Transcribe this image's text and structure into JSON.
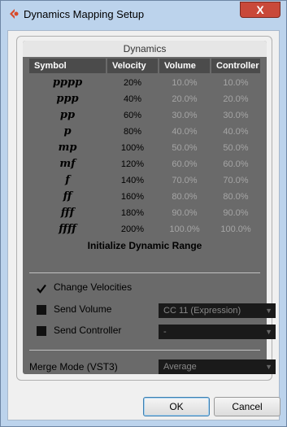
{
  "window": {
    "title": "Dynamics Mapping Setup",
    "close_label": "X"
  },
  "section_title": "Dynamics",
  "columns": [
    "Symbol",
    "Velocity",
    "Volume",
    "Controller"
  ],
  "rows": [
    {
      "symbol": "pppp",
      "velocity": "20%",
      "volume": "10.0%",
      "controller": "10.0%"
    },
    {
      "symbol": "ppp",
      "velocity": "40%",
      "volume": "20.0%",
      "controller": "20.0%"
    },
    {
      "symbol": "pp",
      "velocity": "60%",
      "volume": "30.0%",
      "controller": "30.0%"
    },
    {
      "symbol": "p",
      "velocity": "80%",
      "volume": "40.0%",
      "controller": "40.0%"
    },
    {
      "symbol": "mp",
      "velocity": "100%",
      "volume": "50.0%",
      "controller": "50.0%"
    },
    {
      "symbol": "mf",
      "velocity": "120%",
      "volume": "60.0%",
      "controller": "60.0%"
    },
    {
      "symbol": "f",
      "velocity": "140%",
      "volume": "70.0%",
      "controller": "70.0%"
    },
    {
      "symbol": "ff",
      "velocity": "160%",
      "volume": "80.0%",
      "controller": "80.0%"
    },
    {
      "symbol": "fff",
      "velocity": "180%",
      "volume": "90.0%",
      "controller": "90.0%"
    },
    {
      "symbol": "ffff",
      "velocity": "200%",
      "volume": "100.0%",
      "controller": "100.0%"
    }
  ],
  "init_button": "Initialize Dynamic Range",
  "options": {
    "change_velocities": {
      "label": "Change Velocities",
      "checked": true
    },
    "send_volume": {
      "label": "Send Volume",
      "checked": false,
      "value": "CC 11 (Expression)"
    },
    "send_controller": {
      "label": "Send Controller",
      "checked": false,
      "value": "-"
    }
  },
  "merge_mode": {
    "label": "Merge Mode (VST3)",
    "value": "Average"
  },
  "buttons": {
    "ok": "OK",
    "cancel": "Cancel"
  },
  "colors": {
    "accent_icon": "#d84a2a",
    "close_red": "#c9493a"
  }
}
